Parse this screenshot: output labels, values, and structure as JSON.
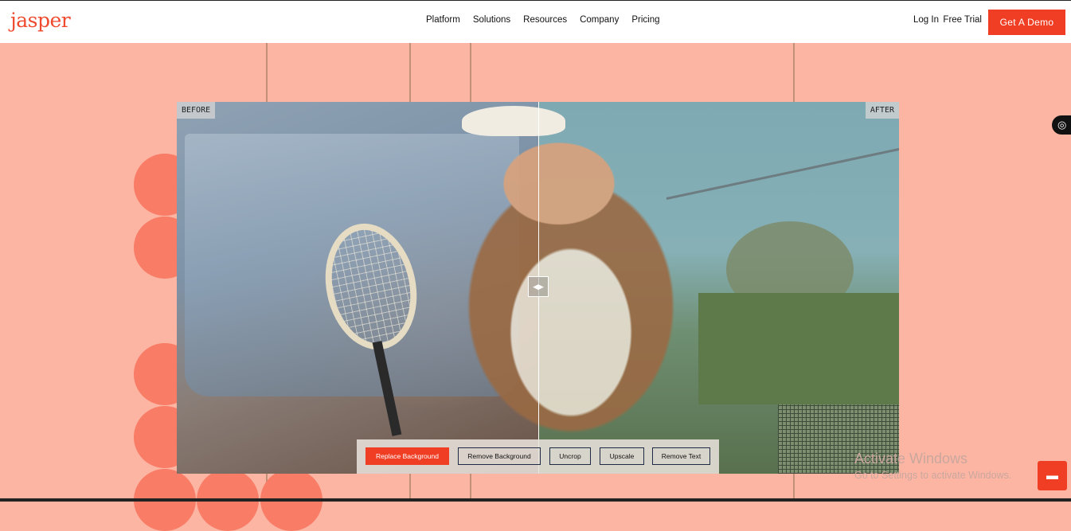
{
  "nav": {
    "logo": "jasper",
    "menu": [
      "Platform",
      "Solutions",
      "Resources",
      "Company",
      "Pricing"
    ],
    "login": "Log In",
    "free_trial": "Free Trial",
    "cta": "Get A Demo"
  },
  "comparison": {
    "before_label": "BEFORE",
    "after_label": "AFTER",
    "handle_glyph": "◀▶"
  },
  "toolbar": {
    "buttons": [
      "Replace Background",
      "Remove Background",
      "Uncrop",
      "Upscale",
      "Remove Text"
    ],
    "active": "Replace Background"
  },
  "watermark": {
    "line1": "Activate Windows",
    "line2": "Go to Settings to activate Windows."
  },
  "icons": {
    "accessibility": "accessibility-icon",
    "chat": "chat-icon"
  },
  "colors": {
    "accent": "#ef3e24",
    "background": "#fdb5a3",
    "circles": "#f87c66"
  }
}
